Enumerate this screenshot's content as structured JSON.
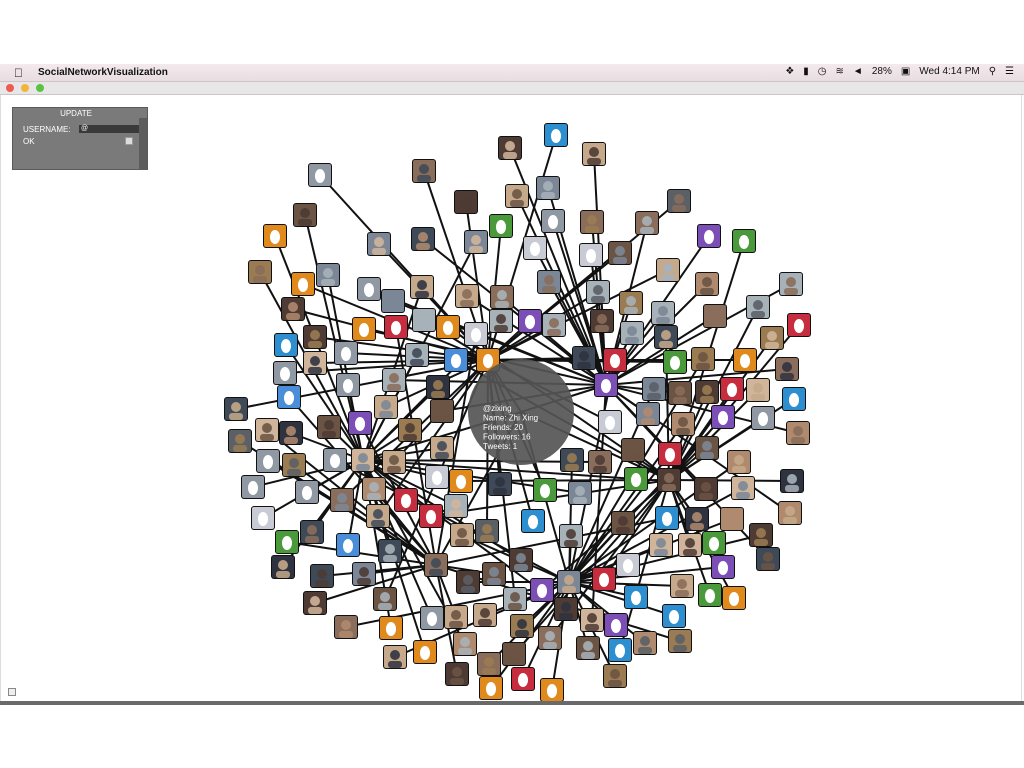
{
  "menubar": {
    "app_name": "SocialNetworkVisualization",
    "battery": "28%",
    "clock": "Wed 4:14 PM"
  },
  "panel": {
    "title": "UPDATE",
    "username_label": "USERNAME:",
    "username_value": "@",
    "ok_label": "OK"
  },
  "center_node": {
    "handle": "@zixing",
    "name_line": "Name: Zhi Xing",
    "friends_line": "Friends: 20",
    "followers_line": "Followers: 16",
    "tweets_line": "Tweets: 1"
  },
  "colors": {
    "link": "#111111",
    "center_disc": "#555555",
    "egg_colors": [
      "#c8cbd3",
      "#e08a1e",
      "#c62e3f",
      "#4a8dd8",
      "#7b4fb6",
      "#4a9a3c",
      "#2e8fd0",
      "#8f98a3"
    ],
    "photo_colors": [
      "#8a6d5a",
      "#3f4a58",
      "#b08a6e",
      "#5b5f66",
      "#9a7b52",
      "#2f3340",
      "#c5a98a",
      "#6b5444",
      "#7b8796",
      "#4d3b34",
      "#a7b1b8",
      "#d0b59b"
    ]
  },
  "graph": {
    "hubs": 6,
    "nodes_per_hub": 34
  }
}
